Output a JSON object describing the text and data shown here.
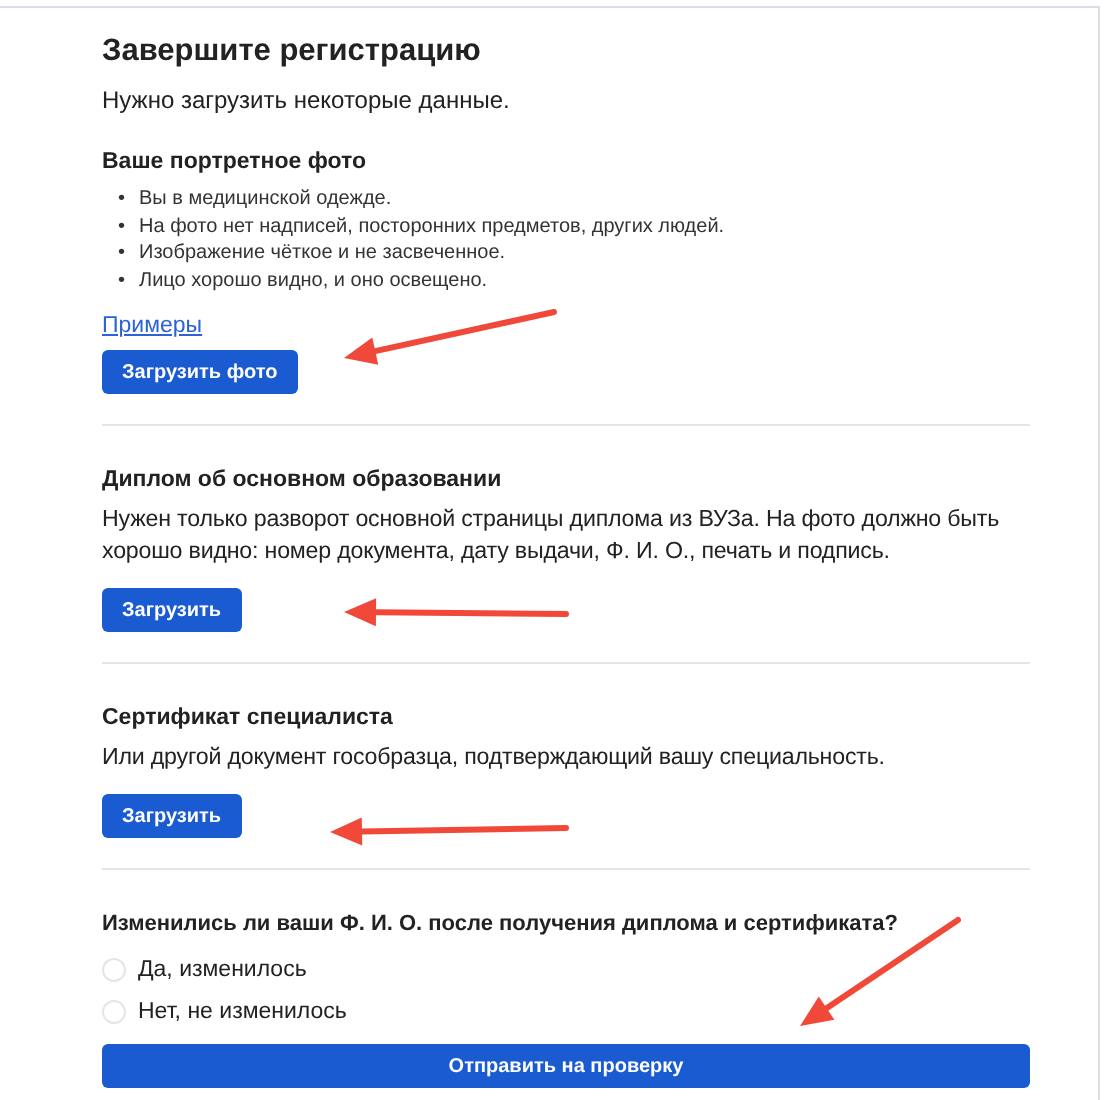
{
  "title": "Завершите регистрацию",
  "subtitle": "Нужно загрузить некоторые данные.",
  "sections": [
    {
      "heading": "Ваше портретное фото",
      "marker": "•",
      "bullets": [
        "Вы в медицинской одежде.",
        "На фото нет надписей, посторонних предметов, других людей.",
        "Изображение чёткое и не засвеченное.",
        "Лицо хорошо видно, и оно освещено."
      ],
      "link": "Примеры",
      "button": "Загрузить фото",
      "arrow": true
    },
    {
      "heading": "Диплом об основном образовании",
      "description": "Нужен только разворот основной страницы диплома из ВУЗа. На фото должно быть хорошо видно: номер документа, дату выдачи, Ф. И. О., печать и подпись.",
      "button": "Загрузить",
      "arrow": true
    },
    {
      "heading": "Сертификат специалиста",
      "description": "Или другой документ гособразца, подтверждающий вашу специальность.",
      "button": "Загрузить",
      "arrow": true
    }
  ],
  "question": {
    "text": "Изменились ли ваши Ф. И. О. после получения диплома и сертификата?",
    "options": [
      {
        "label": "Да, изменилось",
        "selected": false
      },
      {
        "label": "Нет, не изменилось",
        "selected": false
      }
    ]
  },
  "submit": {
    "label": "Отправить на проверку",
    "arrow": true
  }
}
